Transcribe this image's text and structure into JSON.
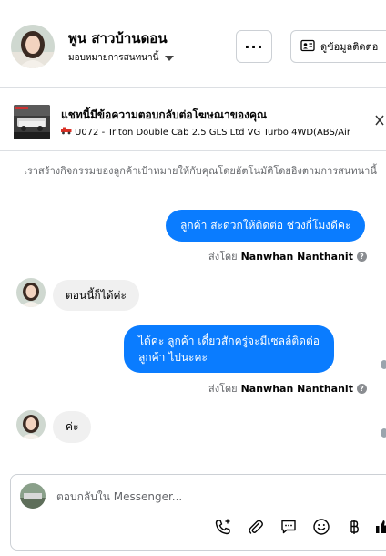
{
  "header": {
    "name": "พูน สาวบ้านดอน",
    "subtitle": "มอบหมายการสนทนานี้",
    "more_label": "···",
    "profile_label": "ดูข้อมูลติดต่อ"
  },
  "ad": {
    "title": "แชทนี้มีข้อความตอบกลับต่อโฆษณาของคุณ",
    "subtitle": "U072 - Triton Double Cab 2.5 GLS Ltd VG Turbo 4WD(ABS/Air"
  },
  "note": "เราสร้างกิจกรรมของลูกค้าเป้าหมายให้กับคุณโดยอัตโนมัติโดยอิงตามการสนทนานี้",
  "messages": {
    "m1": "ลูกค้า  สะดวกให้ติดต่อ ช่วงกี่โมงดีคะ",
    "m1_sent_prefix": "ส่งโดย",
    "m1_sender": "Nanwhan Nanthanit",
    "m2": "ตอนนี้ก็ได้ค่ะ",
    "m3_line1": "ได้ค่ะ  ลูกค้า เดี๋ยวสักครู่จะมีเซลล์ติดต่อ",
    "m3_line2": "ลูกค้า ไปนะคะ",
    "m3_sent_prefix": "ส่งโดย",
    "m3_sender": "Nanwhan Nanthanit",
    "m4": "ค่ะ"
  },
  "composer": {
    "placeholder": "ตอบกลับใน Messenger..."
  },
  "colors": {
    "outgoing_bubble": "#0a7cff",
    "incoming_bubble": "#f0f0f0",
    "muted_text": "#65676b"
  },
  "icons": [
    "ellipsis-icon",
    "contact-card-icon",
    "caret-down-icon",
    "pickup-truck-icon",
    "close-icon",
    "info-icon",
    "phone-plus-icon",
    "paperclip-icon",
    "chat-bubble-icon",
    "emoji-icon",
    "baht-icon",
    "thumbs-up-icon"
  ]
}
